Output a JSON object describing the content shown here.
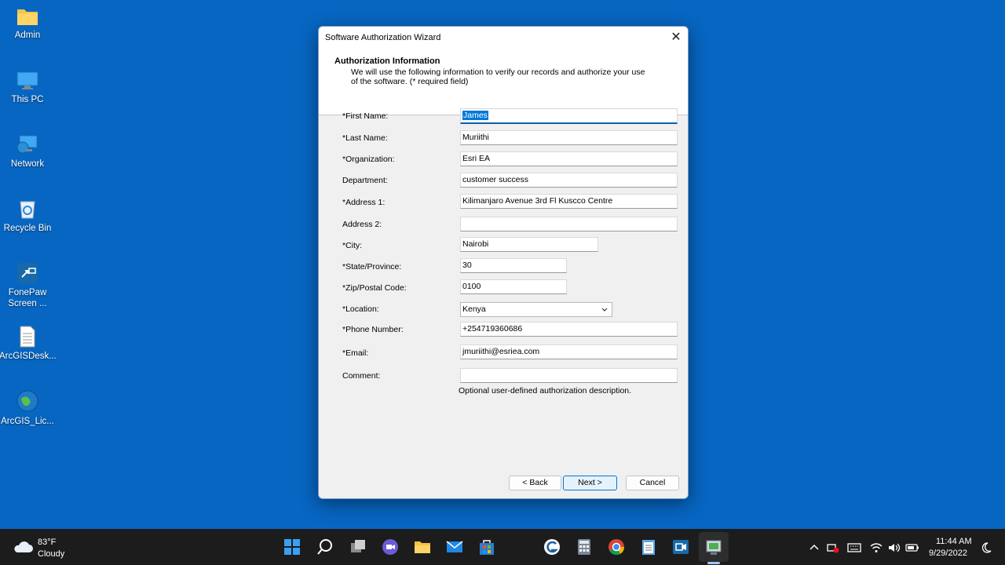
{
  "desktop": {
    "icons": [
      {
        "label": "Admin"
      },
      {
        "label": "This PC"
      },
      {
        "label": "Network"
      },
      {
        "label": "Recycle Bin"
      },
      {
        "label": "FonePaw Screen ..."
      },
      {
        "label": "ArcGISDesk..."
      },
      {
        "label": "ArcGIS_Lic..."
      }
    ]
  },
  "dialog": {
    "title": "Software Authorization Wizard",
    "close_glyph": "✕",
    "header_title": "Authorization Information",
    "header_desc": "We will use the following information to verify our records and authorize your use of the software. (* required field)",
    "fields": [
      {
        "label": "*First Name:",
        "value": "James"
      },
      {
        "label": "*Last Name:",
        "value": "Muriithi"
      },
      {
        "label": "*Organization:",
        "value": "Esri EA"
      },
      {
        "label": "Department:",
        "value": "customer success"
      },
      {
        "label": "*Address 1:",
        "value": "Kilimanjaro Avenue 3rd Fl Kuscco Centre"
      },
      {
        "label": "Address 2:",
        "value": ""
      },
      {
        "label": "*City:",
        "value": "Nairobi"
      },
      {
        "label": "*State/Province:",
        "value": "30"
      },
      {
        "label": "*Zip/Postal Code:",
        "value": "0100"
      },
      {
        "label": "*Location:",
        "value": "Kenya"
      },
      {
        "label": "*Phone Number:",
        "value": "+254719360686"
      },
      {
        "label": "*Email:",
        "value": "jmuriithi@esriea.com"
      },
      {
        "label": "Comment:",
        "value": ""
      }
    ],
    "comment_hint": "Optional user-defined authorization description.",
    "buttons": {
      "back": "< Back",
      "next": "Next >",
      "cancel": "Cancel"
    }
  },
  "taskbar": {
    "weather_temp": "83°F",
    "weather_desc": "Cloudy",
    "time": "11:44 AM",
    "date": "9/29/2022"
  }
}
